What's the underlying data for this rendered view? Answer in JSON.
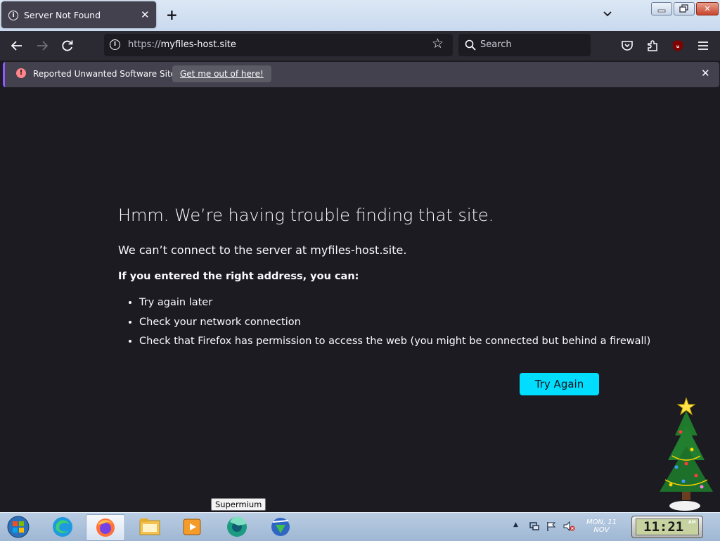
{
  "tab": {
    "title": "Server Not Found",
    "info_icon": "info-icon",
    "close_icon": "close-icon"
  },
  "window": {
    "minimize_icon": "minimize-icon",
    "maximize_icon": "restore-icon",
    "close_glyph": "✕"
  },
  "nav": {
    "url_scheme": "https://",
    "url_host": "myfiles-host.site",
    "search_placeholder": "Search"
  },
  "notification": {
    "message": "Reported Unwanted Software Site!",
    "action_label": "Get me out of here!",
    "accent_color": "#9059ff"
  },
  "error": {
    "title": "Hmm. We’re having trouble finding that site.",
    "description": "We can’t connect to the server at myfiles-host.site.",
    "hint": "If you entered the right address, you can:",
    "suggestions": [
      "Try again later",
      "Check your network connection",
      "Check that Firefox has permission to access the web (you might be connected but behind a firewall)"
    ],
    "try_again_label": "Try Again",
    "button_color": "#00ddff"
  },
  "taskbar": {
    "tooltip": "Supermium",
    "date_line1": "MON, 11",
    "date_line2": "NOV",
    "clock_time": "11:21",
    "clock_ampm": "AM",
    "apps": [
      "start-orb-icon",
      "edge-icon",
      "firefox-icon",
      "file-explorer-icon",
      "media-player-icon",
      "supermium-icon",
      "download-manager-icon"
    ]
  }
}
